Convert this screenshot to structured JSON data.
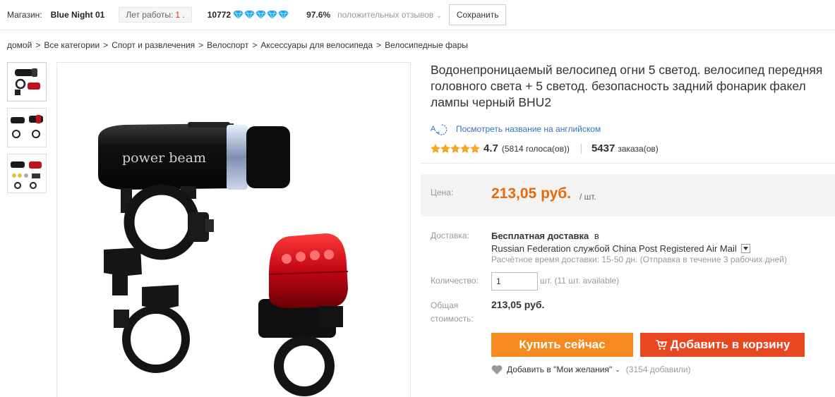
{
  "store": {
    "label": "Магазин:",
    "name": "Blue Night 01",
    "years_label": "Лет работы:",
    "years_value": "1 .",
    "score": "10772",
    "diamond_icon": "diamond-icon",
    "diamond_color": "#1aa7e6",
    "positive_pct": "97.6%",
    "feedback_label": "положительных отзывов",
    "save_label": "Сохранить"
  },
  "breadcrumb": [
    "домой",
    "Все категории",
    "Спорт и развлечения",
    "Велоспорт",
    "Аксессуары для велосипеда",
    "Велосипедные фары"
  ],
  "breadcrumb_sep": ">",
  "product": {
    "title": "Водонепроницаемый велосипед огни 5 светод. велосипед передняя головного света + 5 светод. безопасность задний фонарик факел лампы черный BHU2",
    "translate_label": "Посмотреть название на английском",
    "image_text": "power beam",
    "rating": {
      "value": "4.7",
      "votes": "(5814 голоса(ов))",
      "orders": "5437",
      "orders_label": "заказа(ов)",
      "star_color": "#f5a623"
    }
  },
  "price": {
    "label": "Цена:",
    "value": "213,05 руб.",
    "unit": "/ шт.",
    "color": "#e8690c"
  },
  "delivery": {
    "label": "Доставка:",
    "free": "Бесплатная доставка",
    "in": "в",
    "route": "Russian Federation службой China Post Registered Air Mail",
    "eta": "Расчётное время доставки: 15-50 дн. (Отправка в течение 3 рабочих дней)"
  },
  "quantity": {
    "label": "Количество:",
    "value": "1",
    "note": "шт. (11 шт. available)"
  },
  "total": {
    "label_line1": "Общая",
    "label_line2": "стоимость:",
    "value": "213,05 руб."
  },
  "actions": {
    "buy_label": "Купить сейчас",
    "cart_label": "Добавить в корзину",
    "buy_color": "#f68a1e",
    "cart_color": "#e9471f"
  },
  "wishlist": {
    "label": "Добавить в \"Мои желания\"",
    "count": "(3154 добавили)"
  }
}
